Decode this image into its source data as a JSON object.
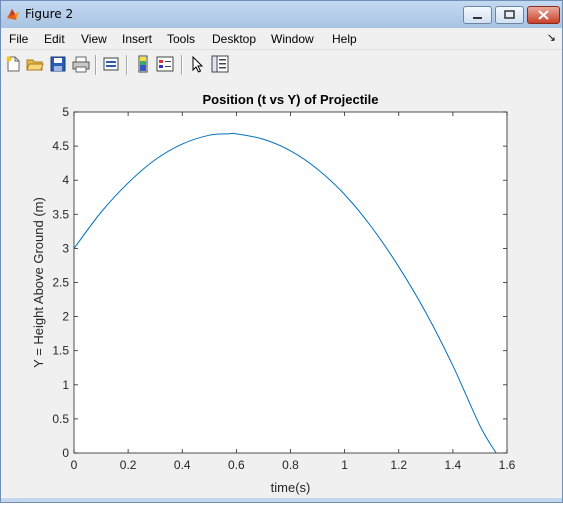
{
  "window": {
    "title": "Figure 2",
    "controls": [
      "minimize",
      "maximize",
      "close"
    ]
  },
  "menu": {
    "items": [
      "File",
      "Edit",
      "View",
      "Insert",
      "Tools",
      "Desktop",
      "Window",
      "Help"
    ],
    "overflow_arrow": "↘"
  },
  "toolbar": {
    "icons": [
      "new-figure-icon",
      "open-file-icon",
      "save-icon",
      "print-icon",
      "link-plot-icon",
      "insert-colorbar-icon",
      "insert-legend-icon",
      "edit-plot-cursor-icon",
      "property-inspector-icon"
    ]
  },
  "colors": {
    "line": "#0072bd",
    "axes_bg": "#ffffff",
    "figure_bg": "#f0f0f0"
  },
  "chart_data": {
    "type": "line",
    "title": "Position (t vs Y) of Projectile",
    "xlabel": "time(s)",
    "ylabel": "Y = Height Above Ground (m)",
    "xlim": [
      0,
      1.6
    ],
    "ylim": [
      0,
      5
    ],
    "xticks": [
      "0",
      "0.2",
      "0.4",
      "0.6",
      "0.8",
      "1",
      "1.2",
      "1.4",
      "1.6"
    ],
    "yticks": [
      "0",
      "0.5",
      "1",
      "1.5",
      "2",
      "2.5",
      "3",
      "3.5",
      "4",
      "4.5",
      "5"
    ],
    "grid": false,
    "series": [
      {
        "x": [
          0,
          0.1,
          0.2,
          0.3,
          0.4,
          0.5,
          0.57,
          0.6,
          0.7,
          0.8,
          0.9,
          1.0,
          1.1,
          1.2,
          1.3,
          1.4,
          1.5,
          1.56
        ],
        "y": [
          3.0,
          3.53,
          3.96,
          4.3,
          4.53,
          4.66,
          4.68,
          4.68,
          4.6,
          4.43,
          4.16,
          3.79,
          3.31,
          2.73,
          2.06,
          1.28,
          0.4,
          0.0
        ]
      }
    ]
  }
}
